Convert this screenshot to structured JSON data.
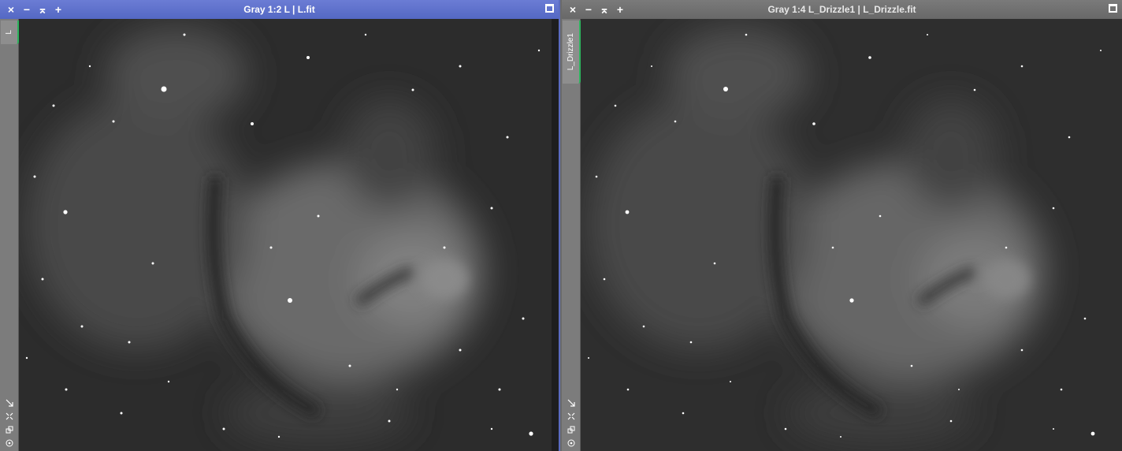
{
  "windows": [
    {
      "id": "left",
      "title": "Gray 1:2 L | L.fit",
      "view_tab": "L",
      "active": true,
      "controls": {
        "close": "×",
        "minimize": "−",
        "shade": "⌅",
        "zoom": "+"
      }
    },
    {
      "id": "right",
      "title": "Gray 1:4 L_Drizzle1 | L_Drizzle.fit",
      "view_tab": "L_Drizzle1",
      "active": false,
      "controls": {
        "close": "×",
        "minimize": "−",
        "shade": "⌅",
        "zoom": "+"
      }
    }
  ],
  "colors": {
    "active_title": "#5a6bc6",
    "inactive_title": "#707070",
    "view_tab_marker": "#2db35d"
  },
  "icons": [
    "close-icon",
    "minimize-icon",
    "shade-icon",
    "zoom-in-icon",
    "maximize-icon",
    "shrink-icon",
    "fit-icon",
    "clone-icon",
    "target-icon"
  ]
}
